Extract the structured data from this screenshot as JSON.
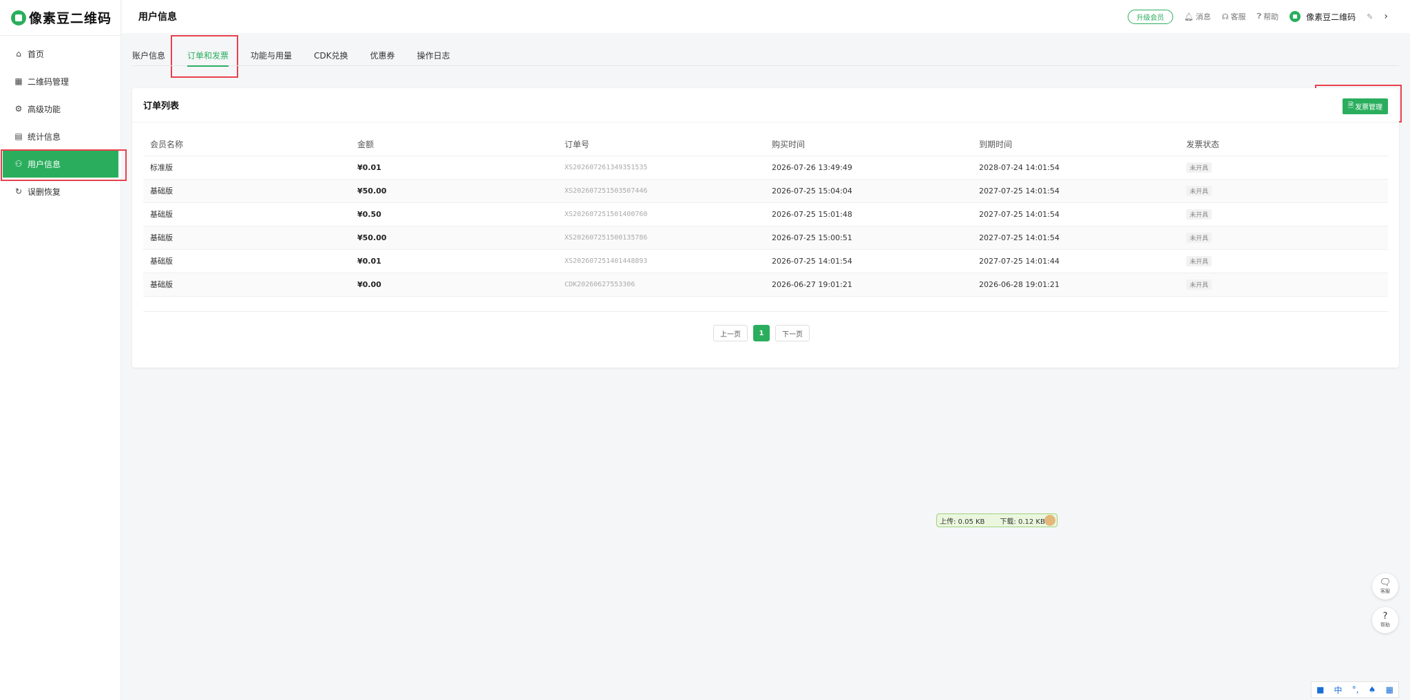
{
  "app": {
    "logo_text": "像素豆二维码"
  },
  "sidebar": {
    "items": [
      {
        "label": "首页",
        "icon": "home-icon",
        "glyph": "⌂"
      },
      {
        "label": "二维码管理",
        "icon": "grid-icon",
        "glyph": "▦"
      },
      {
        "label": "高级功能",
        "icon": "gear-icon",
        "glyph": "⚙"
      },
      {
        "label": "统计信息",
        "icon": "chart-icon",
        "glyph": "▤"
      },
      {
        "label": "用户信息",
        "icon": "user-icon",
        "glyph": "⚇",
        "active": true
      },
      {
        "label": "误删恢复",
        "icon": "restore-icon",
        "glyph": "↻"
      }
    ]
  },
  "header": {
    "title": "用户信息",
    "upgrade_label": "升级会员",
    "messages_label": "消息",
    "service_label": "客服",
    "help_label": "帮助",
    "user_name": "像素豆二维码"
  },
  "tabs": [
    "账户信息",
    "订单和发票",
    "功能与用量",
    "CDK兑换",
    "优惠券",
    "操作日志"
  ],
  "active_tab": 1,
  "orders": {
    "title": "订单列表",
    "invoice_button": "发票管理",
    "columns": [
      "会员名称",
      "金额",
      "订单号",
      "购买时间",
      "到期时间",
      "发票状态"
    ],
    "rows": [
      [
        "标准版",
        "¥0.01",
        "XS202607261349351535",
        "2026-07-26 13:49:49",
        "2028-07-24 14:01:54",
        "未开具"
      ],
      [
        "基础版",
        "¥50.00",
        "XS202607251503507446",
        "2026-07-25 15:04:04",
        "2027-07-25 14:01:54",
        "未开具"
      ],
      [
        "基础版",
        "¥0.50",
        "XS202607251501400760",
        "2026-07-25 15:01:48",
        "2027-07-25 14:01:54",
        "未开具"
      ],
      [
        "基础版",
        "¥50.00",
        "XS202607251500135786",
        "2026-07-25 15:00:51",
        "2027-07-25 14:01:54",
        "未开具"
      ],
      [
        "基础版",
        "¥0.01",
        "XS202607251401448893",
        "2026-07-25 14:01:54",
        "2027-07-25 14:01:44",
        "未开具"
      ],
      [
        "基础版",
        "¥0.00",
        "CDK20260627553306",
        "2026-06-27 19:01:21",
        "2026-06-28 19:01:21",
        "未开具"
      ]
    ]
  },
  "pagination": {
    "prev": "上一页",
    "current": "1",
    "next": "下一页"
  },
  "netspeed": {
    "upload": "上传: 0.05 KB",
    "download": "下载: 0.12 KB"
  },
  "floating": {
    "service": "客服",
    "help": "帮助"
  },
  "ime": {
    "label": "中"
  }
}
